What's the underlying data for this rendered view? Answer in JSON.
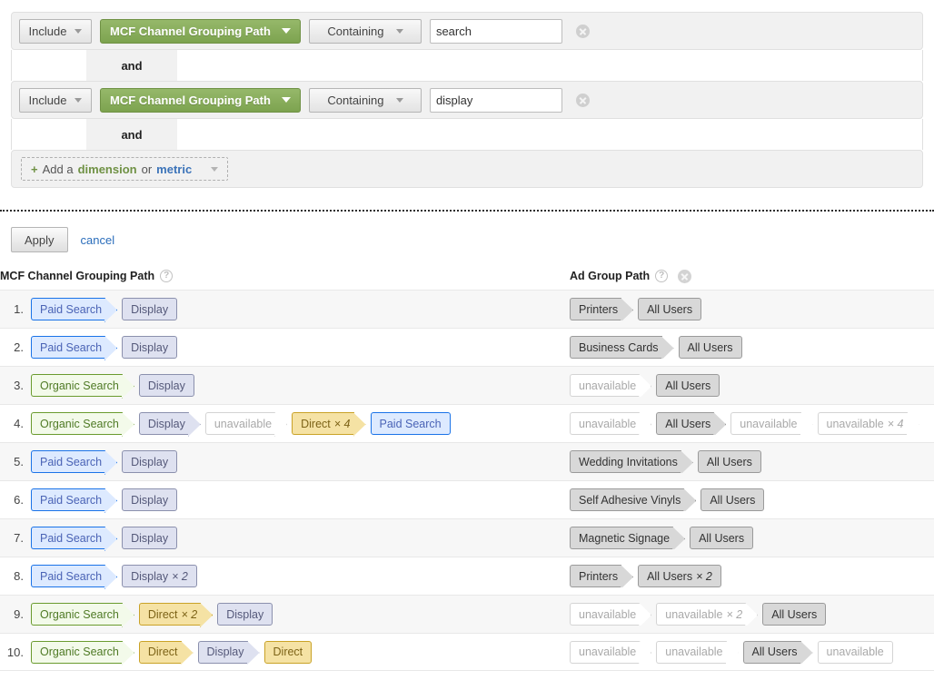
{
  "filter_builder": {
    "rows": [
      {
        "include_label": "Include",
        "dimension_label": "MCF Channel Grouping Path",
        "match_label": "Containing",
        "value": "search",
        "value_placeholder": "",
        "and_label": "and"
      },
      {
        "include_label": "Include",
        "dimension_label": "MCF Channel Grouping Path",
        "match_label": "Containing",
        "value": "display",
        "value_placeholder": "",
        "and_label": "and"
      }
    ],
    "add_row": {
      "plus": "+",
      "text_1": "Add a",
      "word_dimension": "dimension",
      "text_2": "or",
      "word_metric": "metric"
    },
    "apply_label": "Apply",
    "cancel_label": "cancel"
  },
  "table": {
    "columns": [
      {
        "label": "MCF Channel Grouping Path",
        "help": "?"
      },
      {
        "label": "Ad Group Path",
        "help": "?"
      }
    ],
    "rows": [
      {
        "index": "1.",
        "mcf": [
          {
            "label": "Paid Search",
            "mult": "",
            "color": "c-paid",
            "arrow": true,
            "stacked": false
          },
          {
            "label": "Display",
            "mult": "",
            "color": "c-display",
            "arrow": false,
            "stacked": false
          }
        ],
        "adgroup": [
          {
            "label": "Printers",
            "mult": "",
            "color": "c-gray",
            "arrow": true,
            "stacked": false
          },
          {
            "label": "All Users",
            "mult": "",
            "color": "c-gray",
            "arrow": false,
            "stacked": false
          }
        ]
      },
      {
        "index": "2.",
        "mcf": [
          {
            "label": "Paid Search",
            "mult": "",
            "color": "c-paid",
            "arrow": true,
            "stacked": false
          },
          {
            "label": "Display",
            "mult": "",
            "color": "c-display",
            "arrow": false,
            "stacked": false
          }
        ],
        "adgroup": [
          {
            "label": "Business Cards",
            "mult": "",
            "color": "c-gray",
            "arrow": true,
            "stacked": false
          },
          {
            "label": "All Users",
            "mult": "",
            "color": "c-gray",
            "arrow": false,
            "stacked": false
          }
        ]
      },
      {
        "index": "3.",
        "mcf": [
          {
            "label": "Organic Search",
            "mult": "",
            "color": "c-organic",
            "arrow": true,
            "stacked": false
          },
          {
            "label": "Display",
            "mult": "",
            "color": "c-display",
            "arrow": false,
            "stacked": false
          }
        ],
        "adgroup": [
          {
            "label": "unavailable",
            "mult": "",
            "color": "c-unavail",
            "arrow": true,
            "stacked": false
          },
          {
            "label": "All Users",
            "mult": "",
            "color": "c-gray",
            "arrow": false,
            "stacked": false
          }
        ]
      },
      {
        "index": "4.",
        "mcf": [
          {
            "label": "Organic Search",
            "mult": "",
            "color": "c-organic",
            "arrow": true,
            "stacked": false
          },
          {
            "label": "Display",
            "mult": "",
            "color": "c-display",
            "arrow": true,
            "stacked": false
          },
          {
            "label": "unavailable",
            "mult": "",
            "color": "c-unavail",
            "arrow": true,
            "stacked": false
          },
          {
            "label": "Direct",
            "mult": "× 4",
            "color": "c-direct",
            "arrow": true,
            "stacked": true
          },
          {
            "label": "Paid Search",
            "mult": "",
            "color": "c-paid",
            "arrow": false,
            "stacked": false
          }
        ],
        "adgroup": [
          {
            "label": "unavailable",
            "mult": "",
            "color": "c-unavail",
            "arrow": true,
            "stacked": false
          },
          {
            "label": "All Users",
            "mult": "",
            "color": "c-gray",
            "arrow": true,
            "stacked": false
          },
          {
            "label": "unavailable",
            "mult": "",
            "color": "c-unavail",
            "arrow": true,
            "stacked": false
          },
          {
            "label": "unavailable",
            "mult": "× 4",
            "color": "c-unavail",
            "arrow": true,
            "stacked": false
          }
        ]
      },
      {
        "index": "5.",
        "mcf": [
          {
            "label": "Paid Search",
            "mult": "",
            "color": "c-paid",
            "arrow": true,
            "stacked": false
          },
          {
            "label": "Display",
            "mult": "",
            "color": "c-display",
            "arrow": false,
            "stacked": false
          }
        ],
        "adgroup": [
          {
            "label": "Wedding Invitations",
            "mult": "",
            "color": "c-gray",
            "arrow": true,
            "stacked": false
          },
          {
            "label": "All Users",
            "mult": "",
            "color": "c-gray",
            "arrow": false,
            "stacked": false
          }
        ]
      },
      {
        "index": "6.",
        "mcf": [
          {
            "label": "Paid Search",
            "mult": "",
            "color": "c-paid",
            "arrow": true,
            "stacked": false
          },
          {
            "label": "Display",
            "mult": "",
            "color": "c-display",
            "arrow": false,
            "stacked": false
          }
        ],
        "adgroup": [
          {
            "label": "Self Adhesive Vinyls",
            "mult": "",
            "color": "c-gray",
            "arrow": true,
            "stacked": false
          },
          {
            "label": "All Users",
            "mult": "",
            "color": "c-gray",
            "arrow": false,
            "stacked": false
          }
        ]
      },
      {
        "index": "7.",
        "mcf": [
          {
            "label": "Paid Search",
            "mult": "",
            "color": "c-paid",
            "arrow": true,
            "stacked": false
          },
          {
            "label": "Display",
            "mult": "",
            "color": "c-display",
            "arrow": false,
            "stacked": false
          }
        ],
        "adgroup": [
          {
            "label": "Magnetic Signage",
            "mult": "",
            "color": "c-gray",
            "arrow": true,
            "stacked": false
          },
          {
            "label": "All Users",
            "mult": "",
            "color": "c-gray",
            "arrow": false,
            "stacked": false
          }
        ]
      },
      {
        "index": "8.",
        "mcf": [
          {
            "label": "Paid Search",
            "mult": "",
            "color": "c-paid",
            "arrow": true,
            "stacked": false
          },
          {
            "label": "Display",
            "mult": "× 2",
            "color": "c-display",
            "arrow": false,
            "stacked": true
          }
        ],
        "adgroup": [
          {
            "label": "Printers",
            "mult": "",
            "color": "c-gray",
            "arrow": true,
            "stacked": false
          },
          {
            "label": "All Users",
            "mult": "× 2",
            "color": "c-gray",
            "arrow": false,
            "stacked": true
          }
        ]
      },
      {
        "index": "9.",
        "mcf": [
          {
            "label": "Organic Search",
            "mult": "",
            "color": "c-organic",
            "arrow": true,
            "stacked": false
          },
          {
            "label": "Direct",
            "mult": "× 2",
            "color": "c-direct",
            "arrow": true,
            "stacked": true
          },
          {
            "label": "Display",
            "mult": "",
            "color": "c-display",
            "arrow": false,
            "stacked": false
          }
        ],
        "adgroup": [
          {
            "label": "unavailable",
            "mult": "",
            "color": "c-unavail",
            "arrow": true,
            "stacked": false
          },
          {
            "label": "unavailable",
            "mult": "× 2",
            "color": "c-unavail",
            "arrow": true,
            "stacked": false
          },
          {
            "label": "All Users",
            "mult": "",
            "color": "c-gray",
            "arrow": false,
            "stacked": false
          }
        ]
      },
      {
        "index": "10.",
        "mcf": [
          {
            "label": "Organic Search",
            "mult": "",
            "color": "c-organic",
            "arrow": true,
            "stacked": false
          },
          {
            "label": "Direct",
            "mult": "",
            "color": "c-direct",
            "arrow": true,
            "stacked": false
          },
          {
            "label": "Display",
            "mult": "",
            "color": "c-display",
            "arrow": true,
            "stacked": false
          },
          {
            "label": "Direct",
            "mult": "",
            "color": "c-direct",
            "arrow": false,
            "stacked": false
          }
        ],
        "adgroup": [
          {
            "label": "unavailable",
            "mult": "",
            "color": "c-unavail",
            "arrow": true,
            "stacked": false
          },
          {
            "label": "unavailable",
            "mult": "",
            "color": "c-unavail",
            "arrow": true,
            "stacked": false
          },
          {
            "label": "All Users",
            "mult": "",
            "color": "c-gray",
            "arrow": true,
            "stacked": false
          },
          {
            "label": "unavailable",
            "mult": "",
            "color": "c-unavail",
            "arrow": false,
            "stacked": false
          }
        ]
      }
    ]
  }
}
